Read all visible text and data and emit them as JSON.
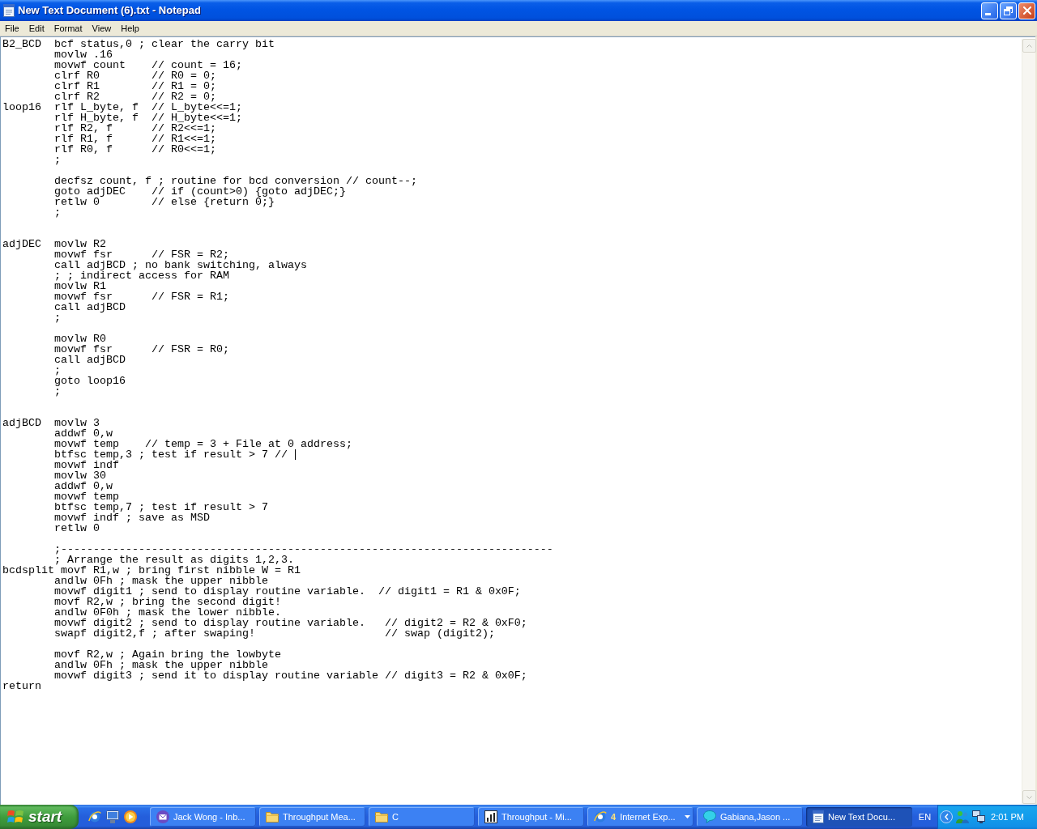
{
  "window": {
    "title": "New Text Document (6).txt - Notepad"
  },
  "menu_bar": [
    "File",
    "Edit",
    "Format",
    "View",
    "Help"
  ],
  "editor": {
    "lines": [
      {
        "kind": "code",
        "label": "B2_BCD",
        "text": "bcf status,0 ; clear the carry bit",
        "caret": false
      },
      {
        "kind": "code",
        "text": "movlw .16",
        "caret": false
      },
      {
        "kind": "code",
        "text": "movwf count    // count = 16;",
        "caret": false
      },
      {
        "kind": "code",
        "text": "clrf R0        // R0 = 0;",
        "caret": false
      },
      {
        "kind": "code",
        "text": "clrf R1        // R1 = 0;",
        "caret": false
      },
      {
        "kind": "code",
        "text": "clrf R2        // R2 = 0;",
        "caret": false
      },
      {
        "kind": "code",
        "label": "loop16",
        "text": "rlf L_byte, f  // L_byte<<=1;",
        "caret": false
      },
      {
        "kind": "code",
        "text": "rlf H_byte, f  // H_byte<<=1;",
        "caret": false
      },
      {
        "kind": "code",
        "text": "rlf R2, f      // R2<<=1;",
        "caret": false
      },
      {
        "kind": "code",
        "text": "rlf R1, f      // R1<<=1;",
        "caret": false
      },
      {
        "kind": "code",
        "text": "rlf R0, f      // R0<<=1;",
        "caret": false
      },
      {
        "kind": "code",
        "text": ";",
        "caret": false
      },
      {
        "kind": "blank",
        "caret": false
      },
      {
        "kind": "code",
        "text": "decfsz count, f ; routine for bcd conversion // count--;",
        "caret": false
      },
      {
        "kind": "code",
        "text": "goto adjDEC    // if (count>0) {goto adjDEC;}",
        "caret": false
      },
      {
        "kind": "code",
        "text": "retlw 0        // else {return 0;}",
        "caret": false
      },
      {
        "kind": "code",
        "text": ";",
        "caret": false
      },
      {
        "kind": "blank",
        "caret": false
      },
      {
        "kind": "blank",
        "caret": false
      },
      {
        "kind": "code",
        "label": "adjDEC",
        "text": "movlw R2",
        "caret": false
      },
      {
        "kind": "code",
        "text": "movwf fsr      // FSR = R2;",
        "caret": false
      },
      {
        "kind": "code",
        "text": "call adjBCD ; no bank switching, always",
        "caret": false
      },
      {
        "kind": "code",
        "text": "; ; indirect access for RAM",
        "caret": false
      },
      {
        "kind": "code",
        "text": "movlw R1",
        "caret": false
      },
      {
        "kind": "code",
        "text": "movwf fsr      // FSR = R1;",
        "caret": false
      },
      {
        "kind": "code",
        "text": "call adjBCD",
        "caret": false
      },
      {
        "kind": "code",
        "text": ";",
        "caret": false
      },
      {
        "kind": "blank",
        "caret": false
      },
      {
        "kind": "code",
        "text": "movlw R0",
        "caret": false
      },
      {
        "kind": "code",
        "text": "movwf fsr      // FSR = R0;",
        "caret": false
      },
      {
        "kind": "code",
        "text": "call adjBCD",
        "caret": false
      },
      {
        "kind": "code",
        "text": ";",
        "caret": false
      },
      {
        "kind": "code",
        "text": "goto loop16",
        "caret": false
      },
      {
        "kind": "code",
        "text": ";",
        "caret": false
      },
      {
        "kind": "blank",
        "caret": false
      },
      {
        "kind": "blank",
        "caret": false
      },
      {
        "kind": "code",
        "label": "adjBCD",
        "text": "movlw 3",
        "caret": false
      },
      {
        "kind": "code",
        "text": "addwf 0,w",
        "caret": false
      },
      {
        "kind": "code",
        "text": "movwf temp    // temp = 3 + File at 0 address;",
        "caret": false
      },
      {
        "kind": "code",
        "text": "btfsc temp,3 ; test if result > 7 //",
        "caret": true
      },
      {
        "kind": "code",
        "text": "movwf indf",
        "caret": false
      },
      {
        "kind": "code",
        "text": "movlw 30",
        "caret": false
      },
      {
        "kind": "code",
        "text": "addwf 0,w",
        "caret": false
      },
      {
        "kind": "code",
        "text": "movwf temp",
        "caret": false
      },
      {
        "kind": "code",
        "text": "btfsc temp,7 ; test if result > 7",
        "caret": false
      },
      {
        "kind": "code",
        "text": "movwf indf ; save as MSD",
        "caret": false
      },
      {
        "kind": "code",
        "text": "retlw 0",
        "caret": false
      },
      {
        "kind": "blank",
        "caret": false
      },
      {
        "kind": "code",
        "text": ";----------------------------------------------------------------------------",
        "caret": false
      },
      {
        "kind": "code",
        "text": "; Arrange the result as digits 1,2,3.",
        "caret": false
      },
      {
        "kind": "code",
        "label": "bcdsplit",
        "text": "movf R1,w ; bring first nibble W = R1",
        "caret": false
      },
      {
        "kind": "code",
        "text": "andlw 0Fh ; mask the upper nibble",
        "caret": false
      },
      {
        "kind": "code",
        "text": "movwf digit1 ; send to display routine variable.  // digit1 = R1 & 0x0F;",
        "caret": false
      },
      {
        "kind": "code",
        "text": "movf R2,w ; bring the second digit!",
        "caret": false
      },
      {
        "kind": "code",
        "text": "andlw 0F0h ; mask the lower nibble.",
        "caret": false
      },
      {
        "kind": "code",
        "text": "movwf digit2 ; send to display routine variable.   // digit2 = R2 & 0xF0;",
        "caret": false
      },
      {
        "kind": "code",
        "text": "swapf digit2,f ; after swaping!                    // swap (digit2);",
        "caret": false
      },
      {
        "kind": "blank",
        "caret": false
      },
      {
        "kind": "code",
        "text": "movf R2,w ; Again bring the lowbyte",
        "caret": false
      },
      {
        "kind": "code",
        "text": "andlw 0Fh ; mask the upper nibble",
        "caret": false
      },
      {
        "kind": "code",
        "text": "movwf digit3 ; send it to display routine variable // digit3 = R2 & 0x0F;",
        "caret": false
      },
      {
        "kind": "code",
        "label": "return",
        "caret": false
      }
    ]
  },
  "taskbar": {
    "start": "start",
    "tasks": [
      {
        "kind": "window",
        "label": "Jack Wong - Inb...",
        "selected": false
      },
      {
        "kind": "window",
        "label": "Throughput Mea...",
        "selected": false
      },
      {
        "kind": "window",
        "label": "C",
        "selected": false
      },
      {
        "kind": "window",
        "label": "Throughput - Mi...",
        "selected": false
      },
      {
        "kind": "group",
        "count": "4",
        "label": "Internet Exp...",
        "selected": false
      },
      {
        "kind": "window",
        "label": "Gabiana,Jason ...",
        "selected": false
      },
      {
        "kind": "window",
        "label": "New Text Docu...",
        "selected": true
      }
    ],
    "language": "EN",
    "clock": "2:01 PM"
  }
}
